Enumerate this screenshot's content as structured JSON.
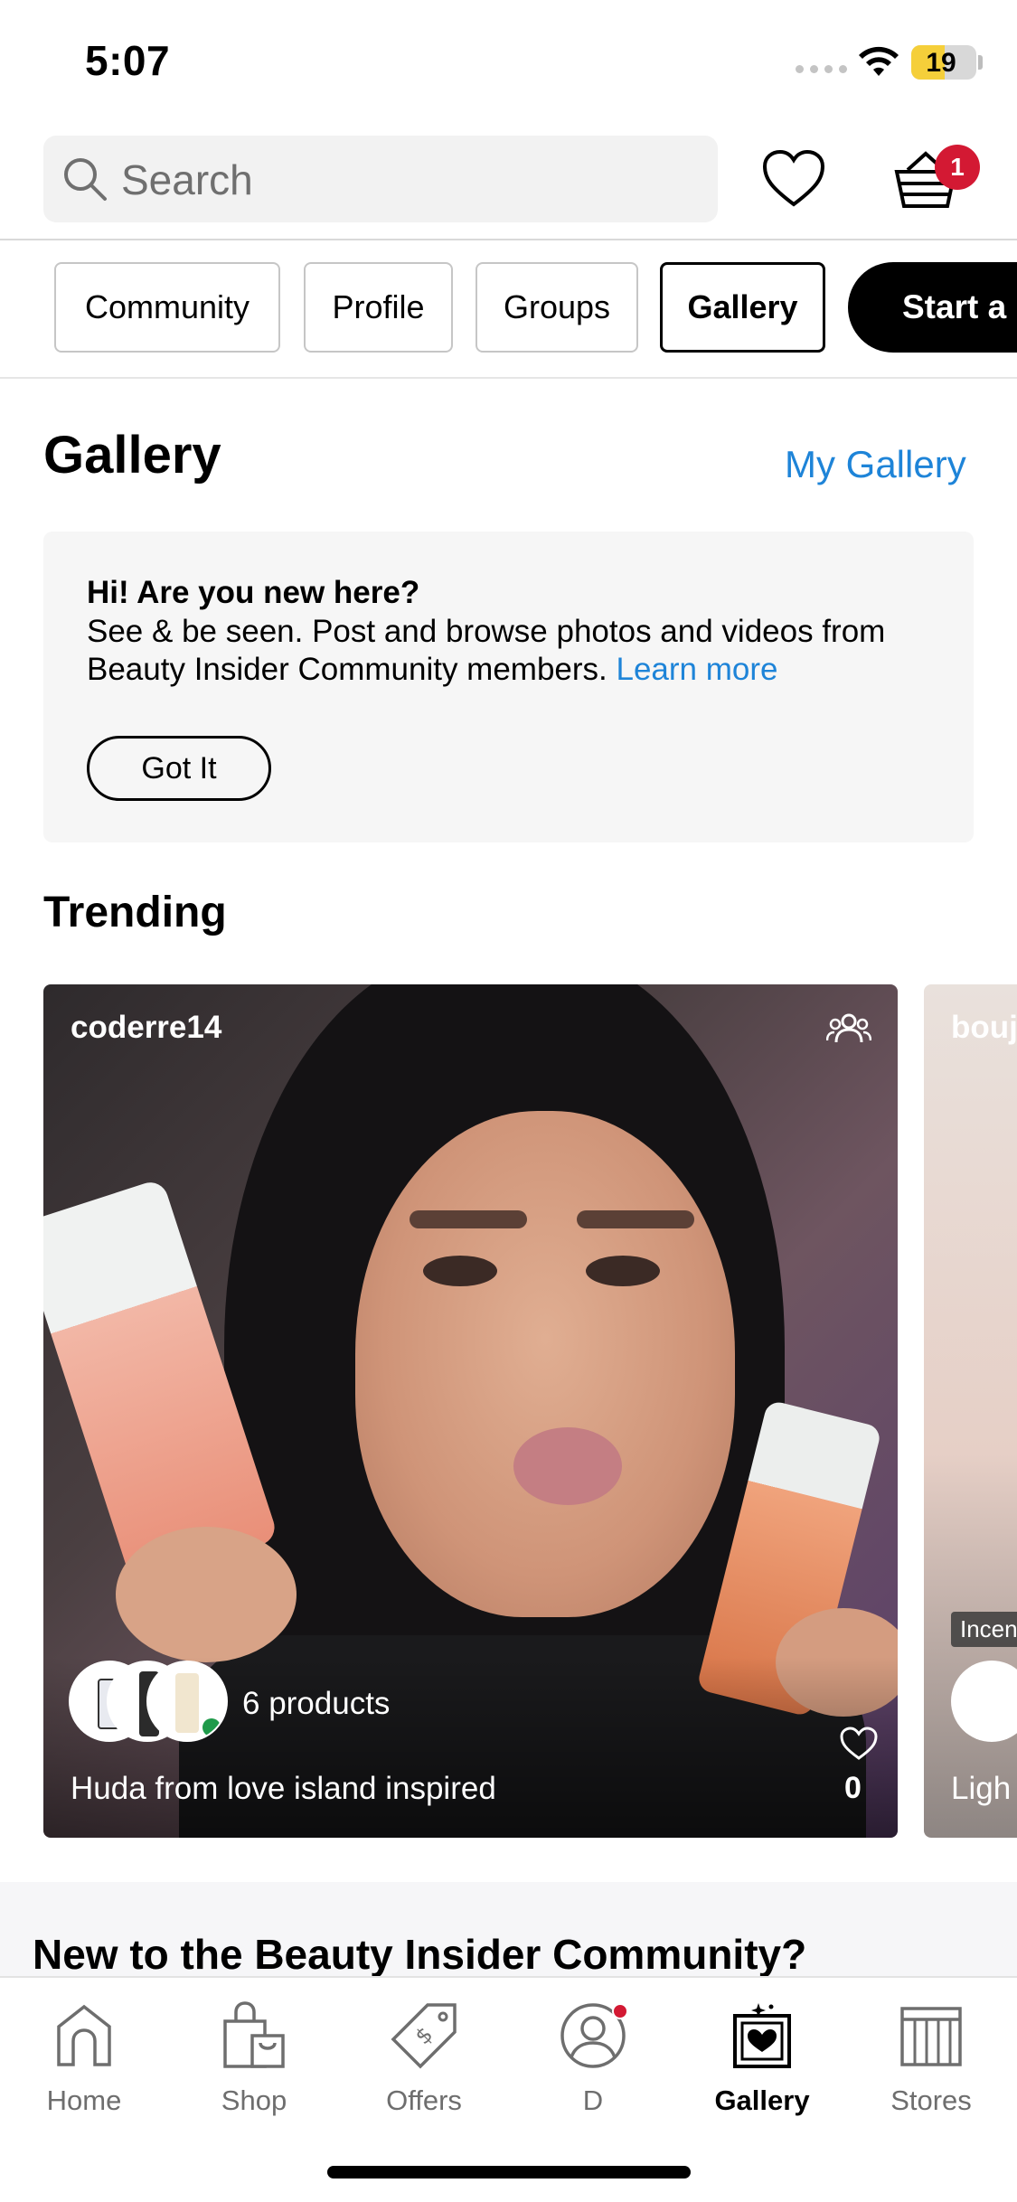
{
  "status_bar": {
    "time": "5:07",
    "battery": "19"
  },
  "header": {
    "search_placeholder": "Search",
    "cart_count": "1"
  },
  "chips": [
    {
      "label": "Community"
    },
    {
      "label": "Profile"
    },
    {
      "label": "Groups"
    },
    {
      "label": "Gallery",
      "active": true
    },
    {
      "label": "Start a"
    }
  ],
  "page": {
    "title": "Gallery",
    "my_gallery_link": "My Gallery"
  },
  "welcome": {
    "title": "Hi! Are you new here?",
    "body": "See & be seen. Post and browse photos and videos from Beauty Insider Community members.",
    "link": "Learn more",
    "button": "Got It"
  },
  "trending": {
    "heading": "Trending",
    "posts": [
      {
        "username": "coderre14",
        "products": "6 products",
        "caption": "Huda from love island inspired",
        "likes": "0"
      },
      {
        "username": "bouj",
        "tag": "Incen",
        "caption": "Ligh"
      }
    ]
  },
  "community_banner": {
    "title": "New to the Beauty Insider Community?"
  },
  "tab_bar": [
    {
      "label": "Home",
      "icon": "home-icon"
    },
    {
      "label": "Shop",
      "icon": "shop-bag-icon"
    },
    {
      "label": "Offers",
      "icon": "offers-tag-icon"
    },
    {
      "label": "D",
      "icon": "community-profile-icon"
    },
    {
      "label": "Gallery",
      "icon": "gallery-icon",
      "active": true
    },
    {
      "label": "Stores",
      "icon": "stores-icon"
    }
  ],
  "colors": {
    "link_blue": "#1e84d8",
    "badge_red": "#d31933",
    "battery_yellow": "#f5cf3a"
  }
}
